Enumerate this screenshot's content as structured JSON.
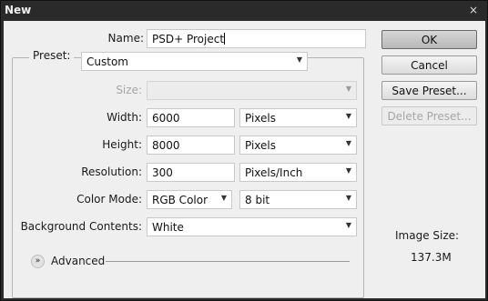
{
  "window": {
    "title": "New",
    "close_glyph": "×"
  },
  "form": {
    "name_label": "Name:",
    "name_value": "PSD+ Project",
    "preset_label": "Preset:",
    "preset_value": "Custom",
    "size_label": "Size:",
    "size_value": "",
    "width_label": "Width:",
    "width_value": "6000",
    "width_unit": "Pixels",
    "height_label": "Height:",
    "height_value": "8000",
    "height_unit": "Pixels",
    "resolution_label": "Resolution:",
    "resolution_value": "300",
    "resolution_unit": "Pixels/Inch",
    "color_mode_label": "Color Mode:",
    "color_mode_value": "RGB Color",
    "bit_depth_value": "8 bit",
    "background_label": "Background Contents:",
    "background_value": "White",
    "advanced_label": "Advanced"
  },
  "buttons": {
    "ok": "OK",
    "cancel": "Cancel",
    "save_preset": "Save Preset...",
    "delete_preset": "Delete Preset..."
  },
  "image_size": {
    "label": "Image Size:",
    "value": "137.3M"
  },
  "icons": {
    "dropdown_caret": "caret-down-icon",
    "advanced_toggle": "double-chevron-down-icon",
    "close": "close-icon"
  }
}
